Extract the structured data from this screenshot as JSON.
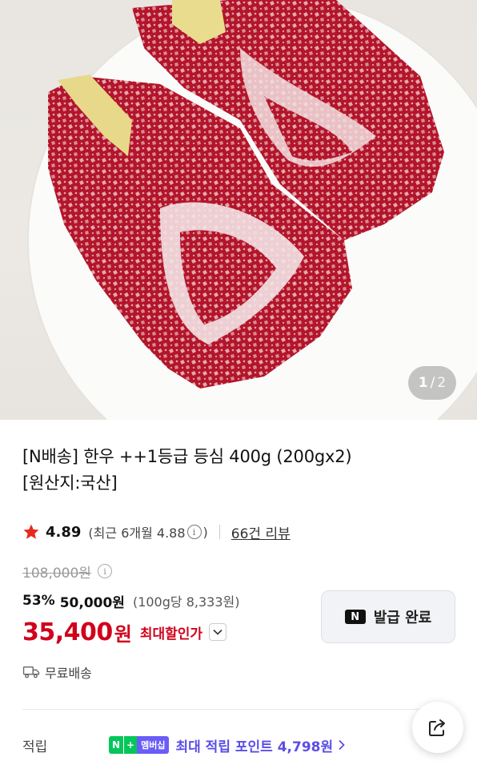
{
  "gallery": {
    "image_alt": "한우 등심",
    "page_current": "1",
    "page_separator": "/",
    "page_total": "2"
  },
  "product": {
    "title_line1": "[N배송] 한우 ++1등급 등심 400g (200gx2)",
    "title_line2": "[원산지:국산]"
  },
  "rating": {
    "icon": "star-icon",
    "score": "4.89",
    "recent_prefix": "(최근 6개월 4.88",
    "recent_suffix": ")",
    "review_link": "66건 리뷰"
  },
  "price": {
    "original": "108,000원",
    "discount_rate": "53%",
    "sale": "50,000원",
    "unit_price": "(100g당 8,333원)",
    "max_discount_value": "35,400",
    "max_discount_unit": "원",
    "max_discount_label": "최대할인가"
  },
  "coupon": {
    "badge": "N",
    "label": "발급 완료"
  },
  "shipping": {
    "icon": "truck-icon",
    "label": "무료배송"
  },
  "points": {
    "label": "적립",
    "badge_n": "N",
    "badge_plus": "+",
    "badge_membership": "멤버십",
    "text": "최대 적립 포인트 4,798원"
  },
  "colors": {
    "accent_red": "#d0021b",
    "membership_purple": "#5b4ee6",
    "naver_green": "#03c75a",
    "star_red": "#e52a1f"
  }
}
